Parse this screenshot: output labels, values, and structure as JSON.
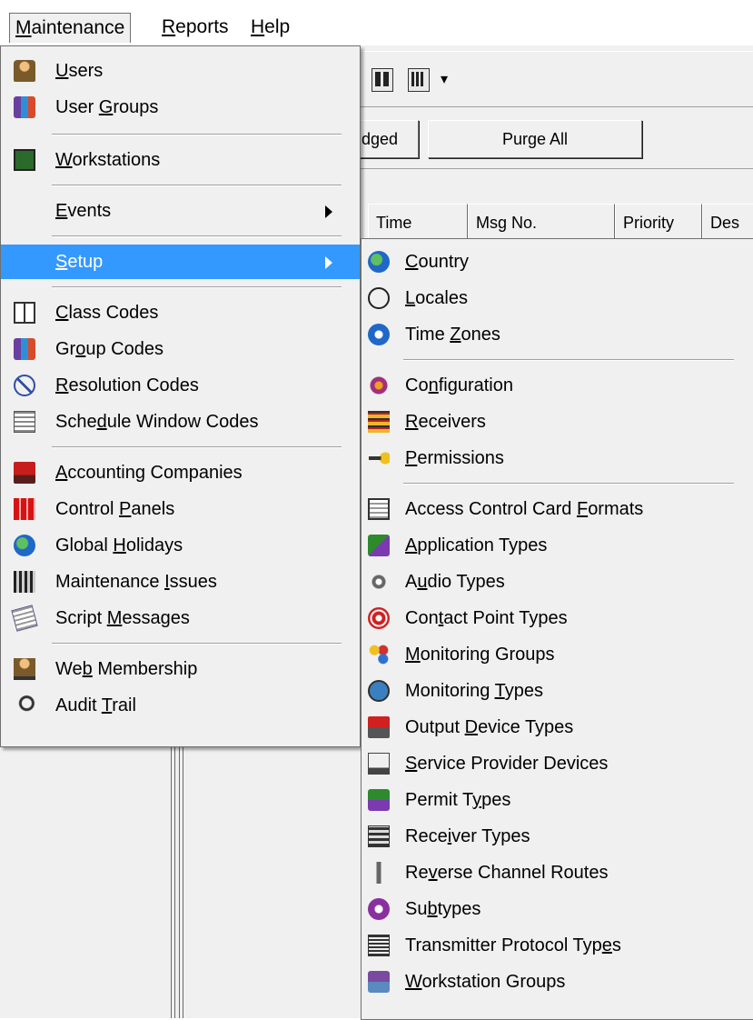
{
  "menubar": {
    "items": [
      {
        "pre": "",
        "u": "M",
        "post": "aintenance"
      },
      {
        "pre": "",
        "u": "R",
        "post": "eports"
      },
      {
        "pre": "",
        "u": "H",
        "post": "elp"
      }
    ]
  },
  "toolbar": {
    "dropdown_glyph": "▾"
  },
  "buttons": {
    "acknowledged": "dged",
    "purge_all": "Purge All"
  },
  "grid": {
    "columns": [
      "Time",
      "Msg No.",
      "Priority",
      "Des"
    ]
  },
  "maintenance_menu": {
    "items": [
      {
        "pre": "",
        "u": "U",
        "post": "sers",
        "icon": "users-icon"
      },
      {
        "pre": "User ",
        "u": "G",
        "post": "roups",
        "icon": "user-groups-icon"
      },
      {
        "pre": "",
        "u": "W",
        "post": "orkstations",
        "icon": "workstations-icon"
      },
      {
        "pre": "",
        "u": "E",
        "post": "vents",
        "icon": "",
        "submenu": true
      },
      {
        "pre": "",
        "u": "S",
        "post": "etup",
        "icon": "",
        "submenu": true,
        "selected": true
      },
      {
        "pre": "",
        "u": "C",
        "post": "lass Codes",
        "icon": "class-codes-icon"
      },
      {
        "pre": "Gr",
        "u": "o",
        "post": "up Codes",
        "icon": "group-codes-icon"
      },
      {
        "pre": "",
        "u": "R",
        "post": "esolution Codes",
        "icon": "resolution-codes-icon"
      },
      {
        "pre": "Sche",
        "u": "d",
        "post": "ule Window Codes",
        "icon": "schedule-window-codes-icon"
      },
      {
        "pre": "",
        "u": "A",
        "post": "ccounting Companies",
        "icon": "accounting-companies-icon"
      },
      {
        "pre": "Control ",
        "u": "P",
        "post": "anels",
        "icon": "control-panels-icon"
      },
      {
        "pre": "Global ",
        "u": "H",
        "post": "olidays",
        "icon": "global-holidays-icon"
      },
      {
        "pre": "Maintenance ",
        "u": "I",
        "post": "ssues",
        "icon": "maintenance-issues-icon"
      },
      {
        "pre": "Script ",
        "u": "M",
        "post": "essages",
        "icon": "script-messages-icon"
      },
      {
        "pre": "We",
        "u": "b",
        "post": " Membership",
        "icon": "web-membership-icon"
      },
      {
        "pre": "Audit ",
        "u": "T",
        "post": "rail",
        "icon": "audit-trail-icon"
      }
    ]
  },
  "setup_menu": {
    "items": [
      {
        "pre": "",
        "u": "C",
        "post": "ountry",
        "icon": "country-globe-icon"
      },
      {
        "pre": "",
        "u": "L",
        "post": "ocales",
        "icon": "locales-icon"
      },
      {
        "pre": "Time ",
        "u": "Z",
        "post": "ones",
        "icon": "time-zones-icon"
      },
      {
        "pre": "Co",
        "u": "n",
        "post": "figuration",
        "icon": "configuration-icon"
      },
      {
        "pre": "",
        "u": "R",
        "post": "eceivers",
        "icon": "receivers-icon"
      },
      {
        "pre": "",
        "u": "P",
        "post": "ermissions",
        "icon": "permissions-key-icon"
      },
      {
        "pre": "Access Control Card ",
        "u": "F",
        "post": "ormats",
        "icon": "access-card-formats-icon"
      },
      {
        "pre": "",
        "u": "A",
        "post": "pplication Types",
        "icon": "application-types-icon"
      },
      {
        "pre": "A",
        "u": "u",
        "post": "dio Types",
        "icon": "audio-types-icon"
      },
      {
        "pre": "Con",
        "u": "t",
        "post": "act Point Types",
        "icon": "contact-point-types-icon"
      },
      {
        "pre": "",
        "u": "M",
        "post": "onitoring Groups",
        "icon": "monitoring-groups-icon"
      },
      {
        "pre": "Monitoring ",
        "u": "T",
        "post": "ypes",
        "icon": "monitoring-types-icon"
      },
      {
        "pre": "Output ",
        "u": "D",
        "post": "evice Types",
        "icon": "output-device-types-icon"
      },
      {
        "pre": "",
        "u": "S",
        "post": "ervice Provider Devices",
        "icon": "service-provider-devices-icon"
      },
      {
        "pre": "Permit T",
        "u": "y",
        "post": "pes",
        "icon": "permit-types-icon"
      },
      {
        "pre": "Rece",
        "u": "i",
        "post": "ver Types",
        "icon": "receiver-types-icon"
      },
      {
        "pre": "Re",
        "u": "v",
        "post": "erse Channel Routes",
        "icon": "reverse-channel-routes-icon"
      },
      {
        "pre": "Su",
        "u": "b",
        "post": "types",
        "icon": "subtypes-icon"
      },
      {
        "pre": "Transmitter Protocol Typ",
        "u": "e",
        "post": "s",
        "icon": "transmitter-protocol-types-icon"
      },
      {
        "pre": "",
        "u": "W",
        "post": "orkstation Groups",
        "icon": "workstation-groups-icon"
      }
    ]
  },
  "colors": {
    "highlight": "#3399ff",
    "menu_bg": "#f0f0f0",
    "border": "#6f6f6f"
  }
}
